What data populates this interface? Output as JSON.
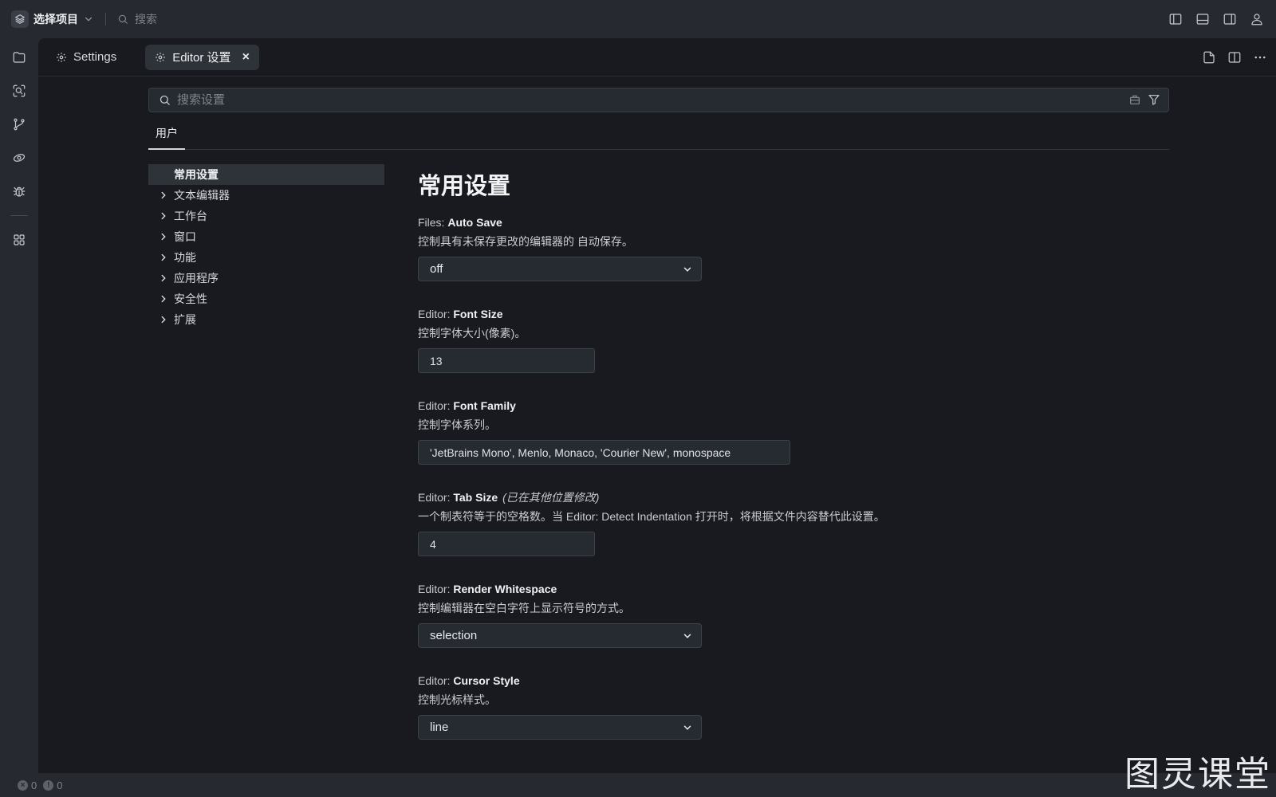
{
  "titlebar": {
    "project_name": "选择项目",
    "search_placeholder": "搜索"
  },
  "tabs": [
    {
      "label": "Settings",
      "active": false
    },
    {
      "label": "Editor 设置",
      "active": true,
      "close": "×"
    }
  ],
  "settings_search": {
    "placeholder": "搜索设置"
  },
  "scope_tab": "用户",
  "tree": {
    "selected": "常用设置",
    "items": [
      "文本编辑器",
      "工作台",
      "窗口",
      "功能",
      "应用程序",
      "安全性",
      "扩展"
    ]
  },
  "content": {
    "heading": "常用设置",
    "settings": [
      {
        "prefix": "Files:",
        "name": "Auto Save",
        "modified": "",
        "desc": "控制具有未保存更改的编辑器的 自动保存。",
        "value": "off",
        "control": "select"
      },
      {
        "prefix": "Editor:",
        "name": "Font Size",
        "modified": "",
        "desc": "控制字体大小(像素)。",
        "value": "13",
        "control": "input-small"
      },
      {
        "prefix": "Editor:",
        "name": "Font Family",
        "modified": "",
        "desc": "控制字体系列。",
        "value": "'JetBrains Mono', Menlo, Monaco, 'Courier New', monospace",
        "control": "input-wide"
      },
      {
        "prefix": "Editor:",
        "name": "Tab Size",
        "modified": "(已在其他位置修改)",
        "desc": "一个制表符等于的空格数。当 Editor: Detect Indentation 打开时，将根据文件内容替代此设置。",
        "value": "4",
        "control": "input-small"
      },
      {
        "prefix": "Editor:",
        "name": "Render Whitespace",
        "modified": "",
        "desc": "控制编辑器在空白字符上显示符号的方式。",
        "value": "selection",
        "control": "select"
      },
      {
        "prefix": "Editor:",
        "name": "Cursor Style",
        "modified": "",
        "desc": "控制光标样式。",
        "value": "line",
        "control": "select"
      }
    ]
  },
  "statusbar": {
    "errors": "0",
    "warnings": "0"
  },
  "watermark": "图灵课堂",
  "icons": {
    "activity": [
      "folder-icon",
      "search-scan-icon",
      "git-branch-icon",
      "remote-explorer-icon",
      "debug-bug-icon",
      "extensions-grid-icon"
    ],
    "titlebar_right": [
      "toggle-left-sidebar-icon",
      "toggle-bottom-panel-icon",
      "toggle-right-sidebar-icon",
      "account-icon"
    ],
    "tab_actions": [
      "open-json-icon",
      "split-editor-icon",
      "more-icon"
    ]
  },
  "colors": {
    "panel_bg": "#181a1f",
    "chrome_bg": "#26292f",
    "control_bg": "#262a31"
  }
}
